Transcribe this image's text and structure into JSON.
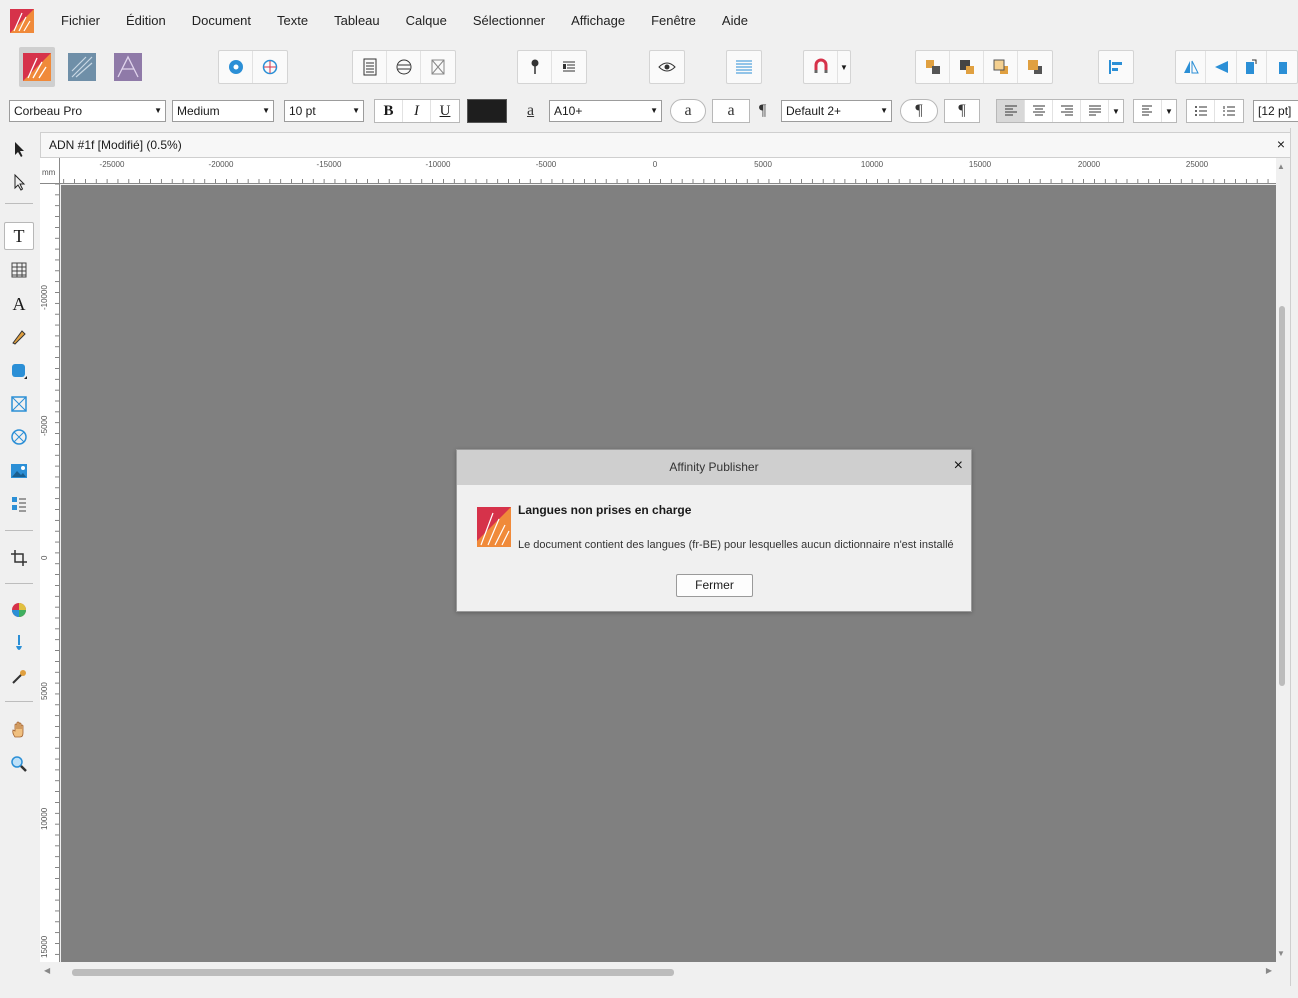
{
  "menu": [
    "Fichier",
    "Édition",
    "Document",
    "Texte",
    "Tableau",
    "Calque",
    "Sélectionner",
    "Affichage",
    "Fenêtre",
    "Aide"
  ],
  "context_toolbar": {
    "font_family": "Corbeau Pro",
    "font_weight": "Medium",
    "font_size": "10 pt",
    "bold_label": "B",
    "italic_label": "I",
    "underline_label": "U",
    "text_color": "#1e1e1e",
    "char_style_glyph": "a",
    "char_style": "A10+",
    "char_glyph_circle": "a",
    "char_glyph_square": "a",
    "para_style_glyph": "¶",
    "para_style": "Default 2+",
    "para_glyph_circle": "¶",
    "para_glyph_square": "¶",
    "leading": "[12 pt]"
  },
  "document_tab": {
    "title": "ADN #1f [Modifié] (0.5%)",
    "close": "×"
  },
  "ruler": {
    "unit": "mm",
    "h_labels": [
      "-25000",
      "-20000",
      "-15000",
      "-10000",
      "-5000",
      "0",
      "5000",
      "10000",
      "15000",
      "20000",
      "25000"
    ],
    "v_labels": [
      "-10000",
      "-5000",
      "0",
      "5000",
      "10000",
      "15000"
    ]
  },
  "dialog": {
    "title": "Affinity Publisher",
    "close": "×",
    "heading": "Langues non prises en charge",
    "message": "Le document contient des langues (fr-BE) pour lesquelles aucun dictionnaire n'est installé",
    "button": "Fermer"
  },
  "colors": {
    "canvas": "#808080",
    "accent_blue": "#2b8fd6",
    "brand_orange": "#f08a3a",
    "brand_red": "#d6324a"
  }
}
